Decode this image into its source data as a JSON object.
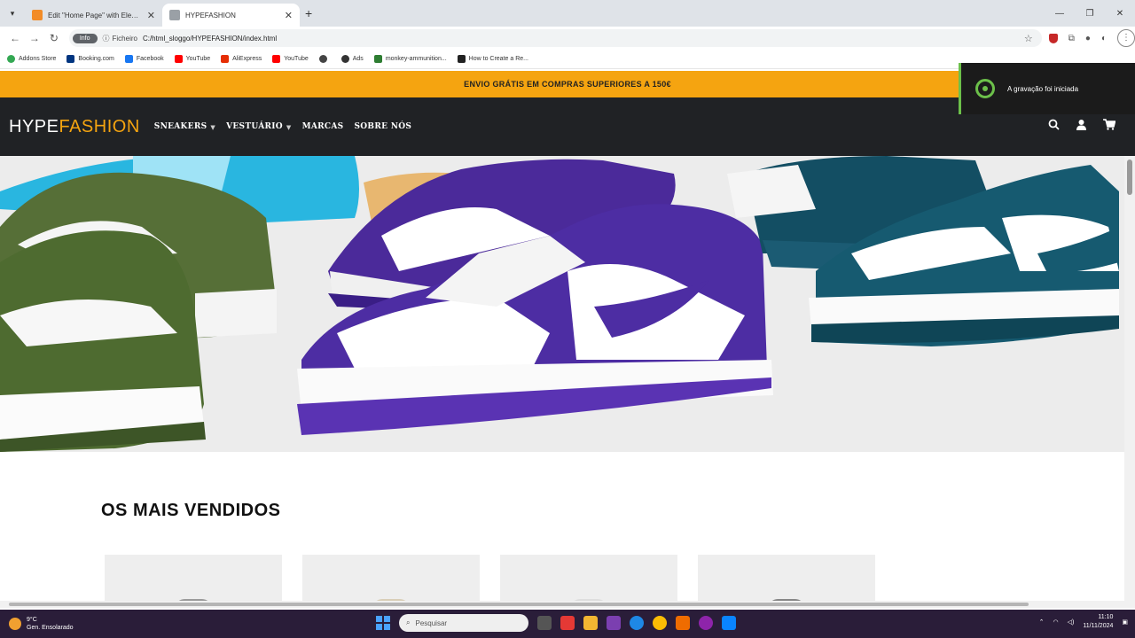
{
  "browser": {
    "tabs": [
      {
        "title": "Edit \"Home Page\" with Elementor",
        "favicon_color": "#f28c28",
        "active": false
      },
      {
        "title": "HYPEFASHION",
        "favicon_color": "#9aa0a6",
        "active": true
      }
    ],
    "address": {
      "badge": "Info",
      "file_chip": "Ficheiro",
      "url": "C:/html_sloggo/HYPEFASHION/index.html"
    },
    "bookmarks": [
      {
        "label": "Addons Store",
        "color": "#34a853"
      },
      {
        "label": "Booking.com",
        "color": "#003580"
      },
      {
        "label": "Facebook",
        "color": "#1877f2"
      },
      {
        "label": "YouTube",
        "color": "#ff0000"
      },
      {
        "label": "AliExpress",
        "color": "#e62e04"
      },
      {
        "label": "YouTube",
        "color": "#ff0000"
      },
      {
        "label": "",
        "color": "#444444"
      },
      {
        "label": "Ads",
        "color": "#333333"
      },
      {
        "label": "monkey-ammunition...",
        "color": "#2e7d32"
      },
      {
        "label": "How to Create a Re...",
        "color": "#222222"
      }
    ]
  },
  "site": {
    "promo_text": "ENVIO GRÁTIS EM COMPRAS SUPERIORES A 150€",
    "logo_part1": "HYPE",
    "logo_part2": "FASHION",
    "brand_color": "#f5a410",
    "nav": [
      {
        "label": "SNEAKERS",
        "dropdown": true
      },
      {
        "label": "VESTUÁRIO",
        "dropdown": true
      },
      {
        "label": "MARCAS",
        "dropdown": false
      },
      {
        "label": "SOBRE NÓS",
        "dropdown": false
      }
    ],
    "section_title": "OS MAIS VENDIDOS",
    "product_count": 4
  },
  "recording_toast": {
    "text": "A gravação foi iniciada",
    "accent": "#6cc04a"
  },
  "taskbar": {
    "weather_temp": "9°C",
    "weather_desc": "Gen. Ensolarado",
    "search_placeholder": "Pesquisar",
    "apps": [
      "#e53935",
      "#f2b632",
      "#7b3fb0",
      "#1e88e5",
      "#fbbc05",
      "#ef6c00",
      "#8e24aa",
      "#0a84ff"
    ],
    "time": "11:10",
    "date": "11/11/2024"
  }
}
